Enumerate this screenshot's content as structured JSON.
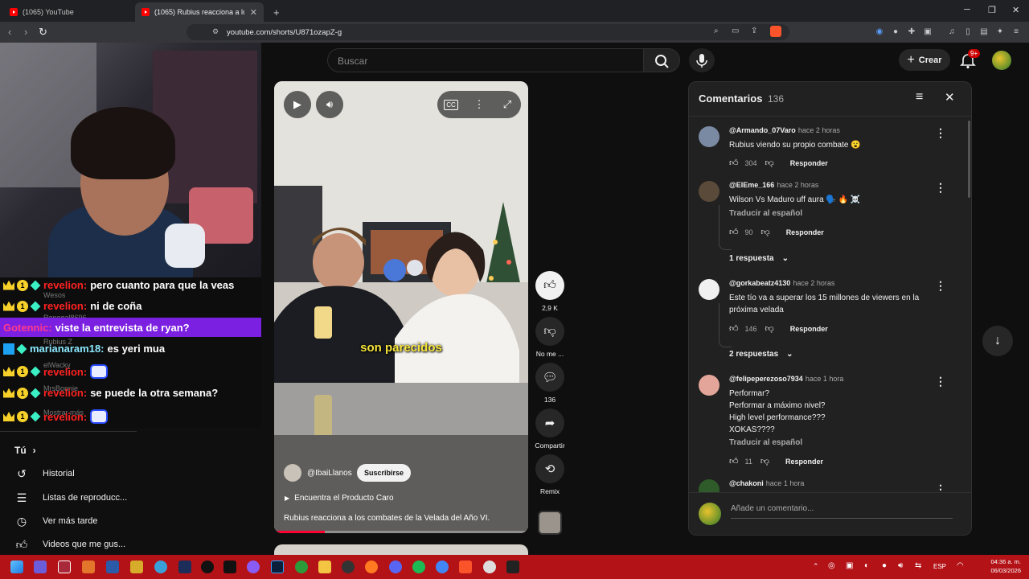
{
  "browser": {
    "tabs": [
      {
        "title": "(1065) YouTube"
      },
      {
        "title": "(1065) Rubius reacciona a los co"
      }
    ],
    "url": "youtube.com/shorts/U871ozapZ-g",
    "new_tab": "+"
  },
  "stream_chat": [
    {
      "user": "revelion:",
      "text": "pero cuanto para que la veas",
      "user_color": "#ff2222"
    },
    {
      "user": "revelion:",
      "text": "ni de coña",
      "user_color": "#ff2222"
    },
    {
      "user": "Gotennic:",
      "text": "viste la entrevista de ryan?",
      "user_color": "#ff3b8d"
    },
    {
      "user": "marianaram18:",
      "text": "es yeri mua",
      "user_color": "#8be9ff"
    },
    {
      "user": "revelion:",
      "text": "",
      "user_color": "#ff2222"
    },
    {
      "user": "revelion:",
      "text": "se puede la otra semana?",
      "user_color": "#ff2222"
    },
    {
      "user": "revelion:",
      "text": "",
      "user_color": "#ff2222"
    }
  ],
  "sidebar": {
    "section_title": "Tú",
    "items": [
      {
        "label": "Historial",
        "icon": "history-icon"
      },
      {
        "label": "Listas de reproducc...",
        "icon": "playlist-icon"
      },
      {
        "label": "Ver más tarde",
        "icon": "clock-icon"
      },
      {
        "label": "Videos que me gus...",
        "icon": "thumbs-up-icon"
      }
    ],
    "ghost_items": [
      "Wesos",
      "Renegal8696",
      "Rubius Z",
      "elWacky",
      "MrsBonnie",
      "Mostrar más"
    ]
  },
  "header": {
    "search_placeholder": "Buscar",
    "create_label": "Crear",
    "notifications_badge": "9+"
  },
  "video": {
    "caption": "son parecidos",
    "channel": "@IbaiLlanos",
    "subscribe_label": "Suscribirse",
    "product_label": "Encuentra el Producto Caro",
    "title": "Rubius reacciona a los combates de la Velada del Año VI.",
    "progress": 0.2
  },
  "actions": {
    "likes": "2,9 K",
    "dislike_label": "No me ...",
    "comments_count": "136",
    "share_label": "Compartir",
    "remix_label": "Remix"
  },
  "comments_panel": {
    "title": "Comentarios",
    "count": "136",
    "add_placeholder": "Añade un comentario...",
    "comments": [
      {
        "user": "@Armando_07Varo",
        "time": "hace 2 horas",
        "text": "Rubius viendo su propio combate 😮",
        "likes": "304",
        "reply": "Responder"
      },
      {
        "user": "@ElEme_166",
        "time": "hace 2 horas",
        "text": "Wilson Vs Maduro uff aura 🗣️ 🔥 ☠️",
        "translate": "Traducir al español",
        "likes": "90",
        "reply": "Responder",
        "replies": "1 respuesta"
      },
      {
        "user": "@gorkabeatz4130",
        "time": "hace 2 horas",
        "text": "Este tío va a superar los 15 millones de viewers en la próxima velada",
        "likes": "146",
        "reply": "Responder",
        "replies": "2 respuestas"
      },
      {
        "user": "@felipeperezoso7934",
        "time": "hace 1 hora",
        "text": "Performar?\nPerformar a máximo nivel?\nHigh level performance???\nXOKAS????",
        "translate": "Traducir al español",
        "likes": "11",
        "reply": "Responder"
      },
      {
        "user": "@chakoni",
        "time": "hace 1 hora"
      }
    ]
  },
  "taskbar": {
    "language": "ESP",
    "time": "04:36 a. m.",
    "date": "06/03/2026"
  }
}
